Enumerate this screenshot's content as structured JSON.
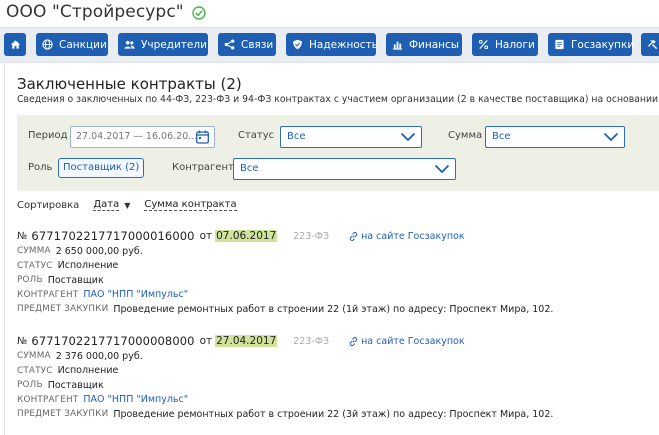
{
  "company": {
    "name": "ООО \"Стройресурс\""
  },
  "nav": [
    {
      "id": "home",
      "label": "",
      "icon": "home-icon"
    },
    {
      "id": "sanctions",
      "label": "Санкции",
      "icon": "globe-icon"
    },
    {
      "id": "founders",
      "label": "Учредители",
      "icon": "users-icon"
    },
    {
      "id": "links",
      "label": "Связи",
      "icon": "share-icon"
    },
    {
      "id": "reliability",
      "label": "Надежность",
      "icon": "shield-icon"
    },
    {
      "id": "finance",
      "label": "Финансы",
      "icon": "chart-icon"
    },
    {
      "id": "taxes",
      "label": "Налоги",
      "icon": "percent-icon"
    },
    {
      "id": "procurement",
      "label": "Госзакупки",
      "icon": "contract-icon"
    },
    {
      "id": "more",
      "label": "",
      "icon": "hammer-icon"
    }
  ],
  "section": {
    "title": "Заключенные контракты (2)",
    "subtitle": "Сведения о заключенных по 44-ФЗ, 223-ФЗ и 94-ФЗ контрактах с участием организации (2 в качестве поставщика) на основании д"
  },
  "filters": {
    "period_label": "Период",
    "period_value": "27.04.2017 — 16.06.20...",
    "status_label": "Статус",
    "status_value": "Все",
    "sum_label": "Сумма",
    "sum_value": "Все",
    "role_label": "Роль",
    "role_value": "Поставщик (2)",
    "counterparty_label": "Контрагент",
    "counterparty_value": "Все"
  },
  "sort": {
    "label": "Сортировка",
    "by_date": "Дата",
    "by_sum": "Сумма контракта"
  },
  "labels": {
    "no": "№",
    "ot": "от",
    "sum": "СУММА",
    "status": "СТАТУС",
    "role": "РОЛЬ",
    "counterparty": "КОНТРАГЕНТ",
    "subject": "ПРЕДМЕТ ЗАКУПКИ",
    "gz_link": "на сайте Госзакупок"
  },
  "contracts": [
    {
      "number": "6771702217717000016000",
      "date": "07.06.2017",
      "law": "223-ФЗ",
      "sum": "2 650 000,00 руб.",
      "status": "Исполнение",
      "role": "Поставщик",
      "counterparty": "ПАО \"НПП \"Импульс\"",
      "subject": "Проведение ремонтных работ в строении 22 (1й этаж) по адресу: Проспект Мира, 102."
    },
    {
      "number": "6771702217717000008000",
      "date": "27.04.2017",
      "law": "223-ФЗ",
      "sum": "2 376 000,00 руб.",
      "status": "Исполнение",
      "role": "Поставщик",
      "counterparty": "ПАО \"НПП \"Импульс\"",
      "subject": "Проведение ремонтных работ в строении 22 (3й этаж) по адресу: Проспект Мира, 102."
    }
  ],
  "colors": {
    "accent": "#1e5fb4",
    "verified": "#4caf50",
    "date_highlight": "#cfe39b",
    "filter_bg": "#eef0e6"
  }
}
